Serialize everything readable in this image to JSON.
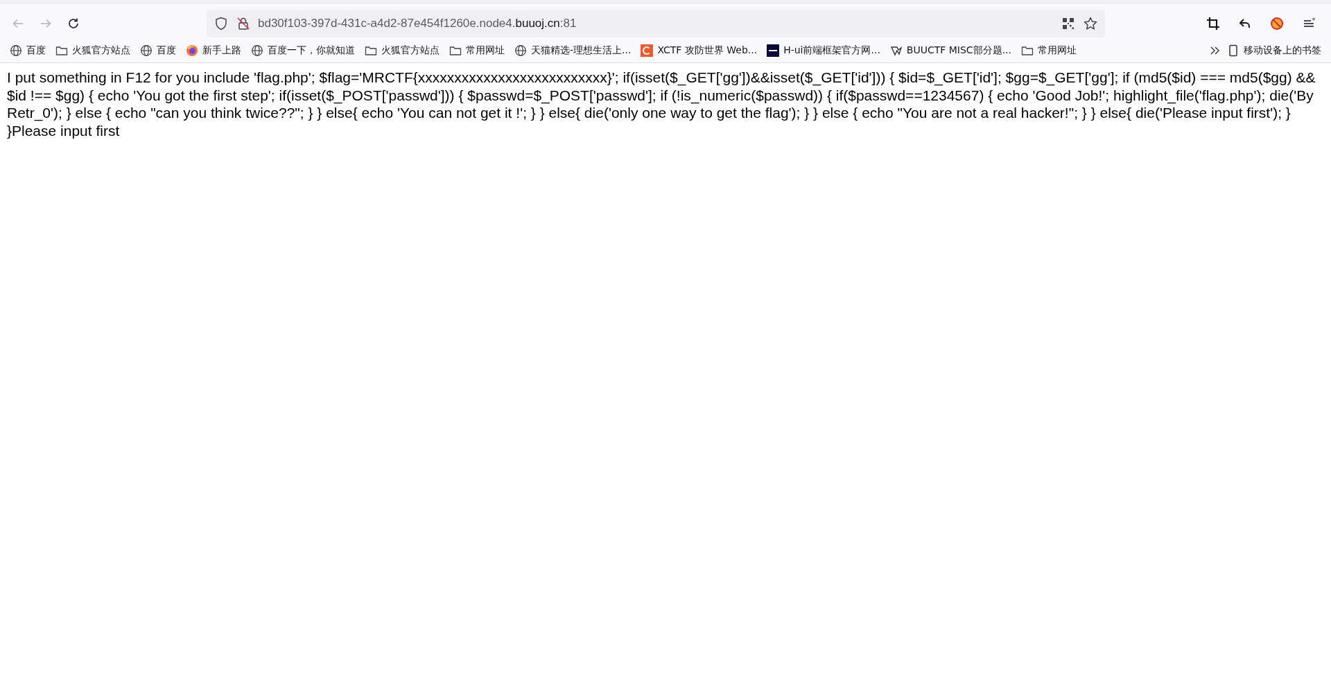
{
  "toolbar": {
    "back_disabled": true,
    "forward_disabled": true,
    "address": {
      "prefix": "bd30f103-397d-431c-a4d2-87e454f1260e.node4.",
      "domain": "buuoj.cn",
      "suffix": ":81"
    }
  },
  "bookmarks": [
    {
      "kind": "globe",
      "label": "百度"
    },
    {
      "kind": "folder",
      "label": "火狐官方站点"
    },
    {
      "kind": "globe",
      "label": "百度"
    },
    {
      "kind": "firefox",
      "label": "新手上路"
    },
    {
      "kind": "globe",
      "label": "百度一下，你就知道"
    },
    {
      "kind": "folder",
      "label": "火狐官方站点"
    },
    {
      "kind": "folder",
      "label": "常用网址"
    },
    {
      "kind": "globe",
      "label": "天猫精选-理想生活上..."
    },
    {
      "kind": "xctf",
      "label": "XCTF 攻防世界 Web..."
    },
    {
      "kind": "hui",
      "label": "H-ui前端框架官方网..."
    },
    {
      "kind": "buu",
      "label": "BUUCTF MISC部分题..."
    },
    {
      "kind": "folder",
      "label": "常用网址"
    }
  ],
  "mobile_bookmarks": "移动设备上的书签",
  "page_text": "I put something in F12 for you include 'flag.php'; $flag='MRCTF{xxxxxxxxxxxxxxxxxxxxxxxxxx}'; if(isset($_GET['gg'])&&isset($_GET['id'])) { $id=$_GET['id']; $gg=$_GET['gg']; if (md5($id) === md5($gg) && $id !== $gg) { echo 'You got the first step'; if(isset($_POST['passwd'])) { $passwd=$_POST['passwd']; if (!is_numeric($passwd)) { if($passwd==1234567) { echo 'Good Job!'; highlight_file('flag.php'); die('By Retr_0'); } else { echo \"can you think twice??\"; } } else{ echo 'You can not get it !'; } } else{ die('only one way to get the flag'); } } else { echo \"You are not a real hacker!\"; } } else{ die('Please input first'); } }Please input first"
}
